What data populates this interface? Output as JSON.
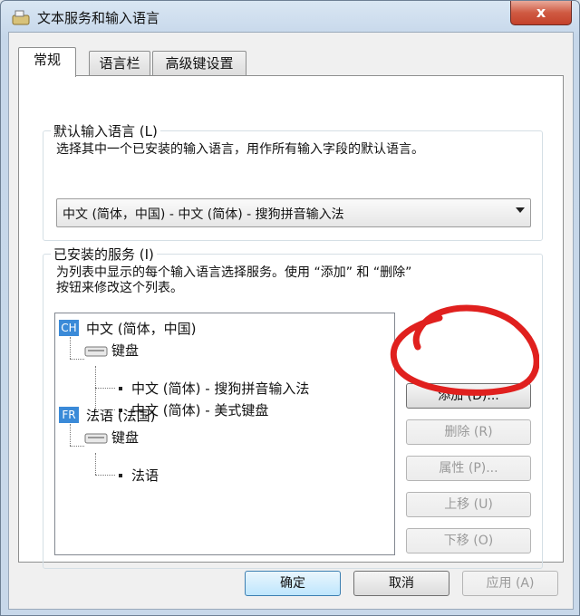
{
  "window": {
    "title": "文本服务和输入语言",
    "close_glyph": "x"
  },
  "tabs": [
    "常规",
    "语言栏",
    "高级键设置"
  ],
  "default_language": {
    "title": "默认输入语言 (L)",
    "description": "选择其中一个已安装的输入语言，用作所有输入字段的默认语言。",
    "selected": "中文 (简体，中国) - 中文 (简体) - 搜狗拼音输入法"
  },
  "installed_services": {
    "title": "已安装的服务 (I)",
    "description_line1": "为列表中显示的每个输入语言选择服务。使用 “添加” 和 “删除”",
    "description_line2": "按钮来修改这个列表。",
    "tree": {
      "lang1": {
        "badge": "CH",
        "name": "中文 (简体，中国)",
        "group": "键盘",
        "items": [
          "中文 (简体) - 搜狗拼音输入法",
          "中文 (简体) - 美式键盘"
        ]
      },
      "lang2": {
        "badge": "FR",
        "name": "法语 (法国)",
        "group": "键盘",
        "items": [
          "法语"
        ]
      }
    },
    "buttons": {
      "add": "添加 (D)...",
      "remove": "删除 (R)",
      "properties": "属性 (P)...",
      "move_up": "上移 (U)",
      "move_down": "下移 (O)"
    }
  },
  "footer": {
    "ok": "确定",
    "cancel": "取消",
    "apply": "应用 (A)"
  },
  "colors": {
    "annotation": "#e0201e",
    "lang_badge": "#3a8ad8"
  }
}
